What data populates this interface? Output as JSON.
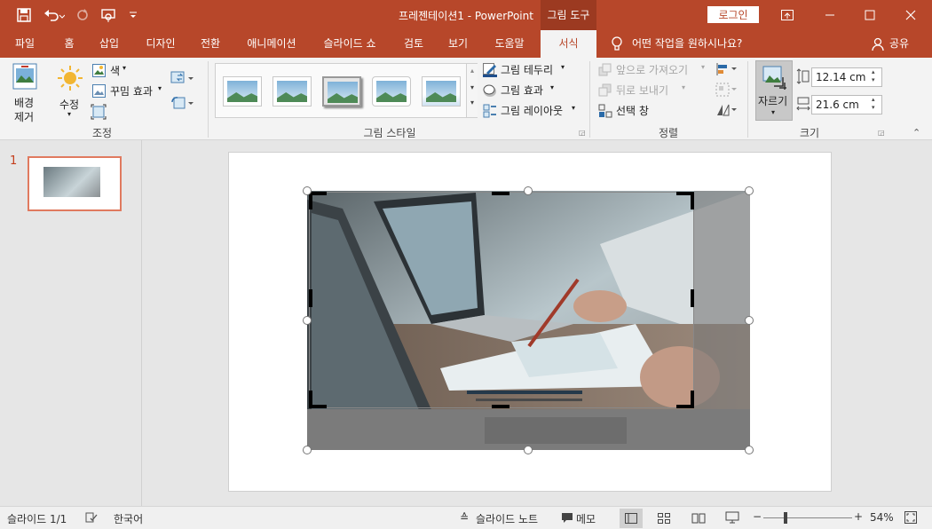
{
  "window": {
    "title": "프레젠테이션1  -  PowerPoint",
    "context_tab_header": "그림 도구",
    "login_label": "로그인"
  },
  "tabs": [
    "파일",
    "홈",
    "삽입",
    "디자인",
    "전환",
    "애니메이션",
    "슬라이드 쇼",
    "검토",
    "보기",
    "도움말",
    "서식"
  ],
  "tell_me": "어떤 작업을 원하시나요?",
  "share_label": "공유",
  "ribbon": {
    "adjust": {
      "remove_bg_line1": "배경",
      "remove_bg_line2": "제거",
      "corrections": "수정",
      "color": "색",
      "artistic": "꾸밈 효과",
      "label": "조정"
    },
    "styles": {
      "border": "그림 테두리",
      "effects": "그림 효과",
      "layout": "그림 레이아웃",
      "label": "그림 스타일"
    },
    "arrange": {
      "bring_forward": "앞으로 가져오기",
      "send_backward": "뒤로 보내기",
      "selection_pane": "선택 창",
      "label": "정렬"
    },
    "size": {
      "crop": "자르기",
      "height": "12.14 cm",
      "width": "21.6 cm",
      "label": "크기"
    }
  },
  "thumbnail_number": "1",
  "status": {
    "slide": "슬라이드 1/1",
    "language": "한국어",
    "notes": "슬라이드 노트",
    "comments": "메모",
    "zoom": "54%"
  },
  "colors": {
    "accent": "#b7472a",
    "accent_dark": "#9c3a21",
    "ribbon_bg": "#f3f3f3"
  }
}
